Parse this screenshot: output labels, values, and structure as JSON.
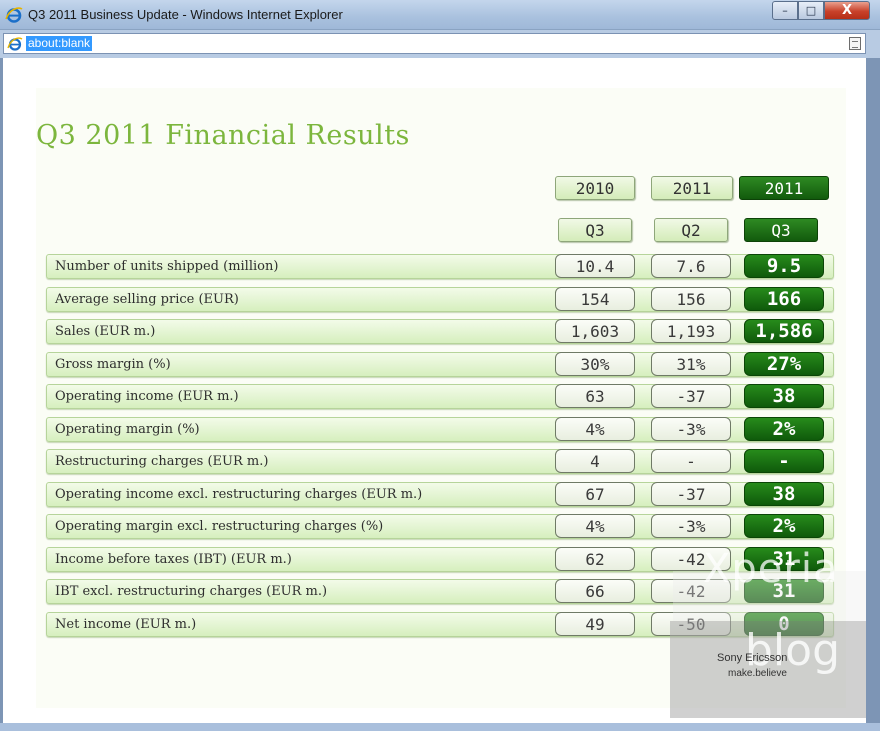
{
  "window": {
    "title": "Q3 2011 Business Update - Windows Internet Explorer",
    "minimize": "–",
    "maximize": "□",
    "close": "X"
  },
  "address": {
    "url": "about:blank"
  },
  "slide": {
    "title": "Q3 2011 Financial Results",
    "columns": [
      {
        "year": "2010",
        "quarter": "Q3"
      },
      {
        "year": "2011",
        "quarter": "Q2"
      },
      {
        "year": "2011",
        "quarter": "Q3"
      }
    ],
    "rows": [
      {
        "label": "Number of units shipped (million)",
        "values": [
          "10.4",
          "7.6",
          "9.5"
        ]
      },
      {
        "label": "Average selling price (EUR)",
        "values": [
          "154",
          "156",
          "166"
        ]
      },
      {
        "label": "Sales (EUR m.)",
        "values": [
          "1,603",
          "1,193",
          "1,586"
        ]
      },
      {
        "label": "Gross margin (%)",
        "values": [
          "30%",
          "31%",
          "27%"
        ]
      },
      {
        "label": "Operating income (EUR m.)",
        "values": [
          "63",
          "-37",
          "38"
        ]
      },
      {
        "label": "Operating margin (%)",
        "values": [
          "4%",
          "-3%",
          "2%"
        ]
      },
      {
        "label": "Restructuring charges (EUR m.)",
        "values": [
          "4",
          "-",
          "-"
        ]
      },
      {
        "label": "Operating income excl. restructuring charges (EUR m.)",
        "values": [
          "67",
          "-37",
          "38"
        ]
      },
      {
        "label": "Operating margin excl. restructuring charges (%)",
        "values": [
          "4%",
          "-3%",
          "2%"
        ]
      },
      {
        "label": "Income before taxes (IBT) (EUR m.)",
        "values": [
          "62",
          "-42",
          "31"
        ]
      },
      {
        "label": "IBT excl. restructuring charges (EUR m.)",
        "values": [
          "66",
          "-42",
          "31"
        ]
      },
      {
        "label": "Net income (EUR m.)",
        "values": [
          "49",
          "-50",
          "0"
        ]
      }
    ]
  },
  "watermark": {
    "brand": "Xperia",
    "blog": "blog",
    "company": "Sony Ericsson",
    "tagline": "make.believe"
  },
  "colors": {
    "title_green": "#7cb63d",
    "highlight_green": "#1b7014",
    "row_green": "#d6efbe"
  }
}
